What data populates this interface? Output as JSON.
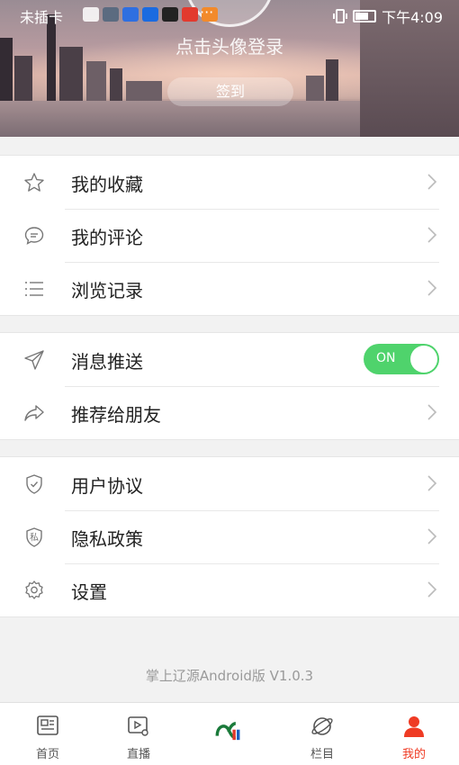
{
  "status_bar": {
    "carrier": "未插卡",
    "more": "···",
    "time": "下午4:09"
  },
  "header": {
    "login_prompt": "点击头像登录",
    "checkin_label": "签到"
  },
  "menu_group_1": [
    {
      "label": "我的收藏",
      "icon": "star-icon"
    },
    {
      "label": "我的评论",
      "icon": "comment-icon"
    },
    {
      "label": "浏览记录",
      "icon": "list-icon"
    }
  ],
  "menu_group_2": [
    {
      "label": "消息推送",
      "icon": "send-icon",
      "toggle": "ON"
    },
    {
      "label": "推荐给朋友",
      "icon": "share-icon"
    }
  ],
  "menu_group_3": [
    {
      "label": "用户协议",
      "icon": "shield-check-icon"
    },
    {
      "label": "隐私政策",
      "icon": "privacy-shield-icon",
      "icon_text": "私"
    },
    {
      "label": "设置",
      "icon": "gear-icon"
    }
  ],
  "footer": {
    "version": "掌上辽源Android版 V1.0.3"
  },
  "tabbar": [
    {
      "label": "首页",
      "icon": "news-icon"
    },
    {
      "label": "直播",
      "icon": "live-video-icon"
    },
    {
      "label": "",
      "icon": "app-logo-icon"
    },
    {
      "label": "栏目",
      "icon": "planet-icon"
    },
    {
      "label": "我的",
      "icon": "user-icon",
      "active": true
    }
  ],
  "colors": {
    "accent": "#ef3b24",
    "toggle_on": "#4fd36c",
    "background": "#f2f2f2"
  }
}
